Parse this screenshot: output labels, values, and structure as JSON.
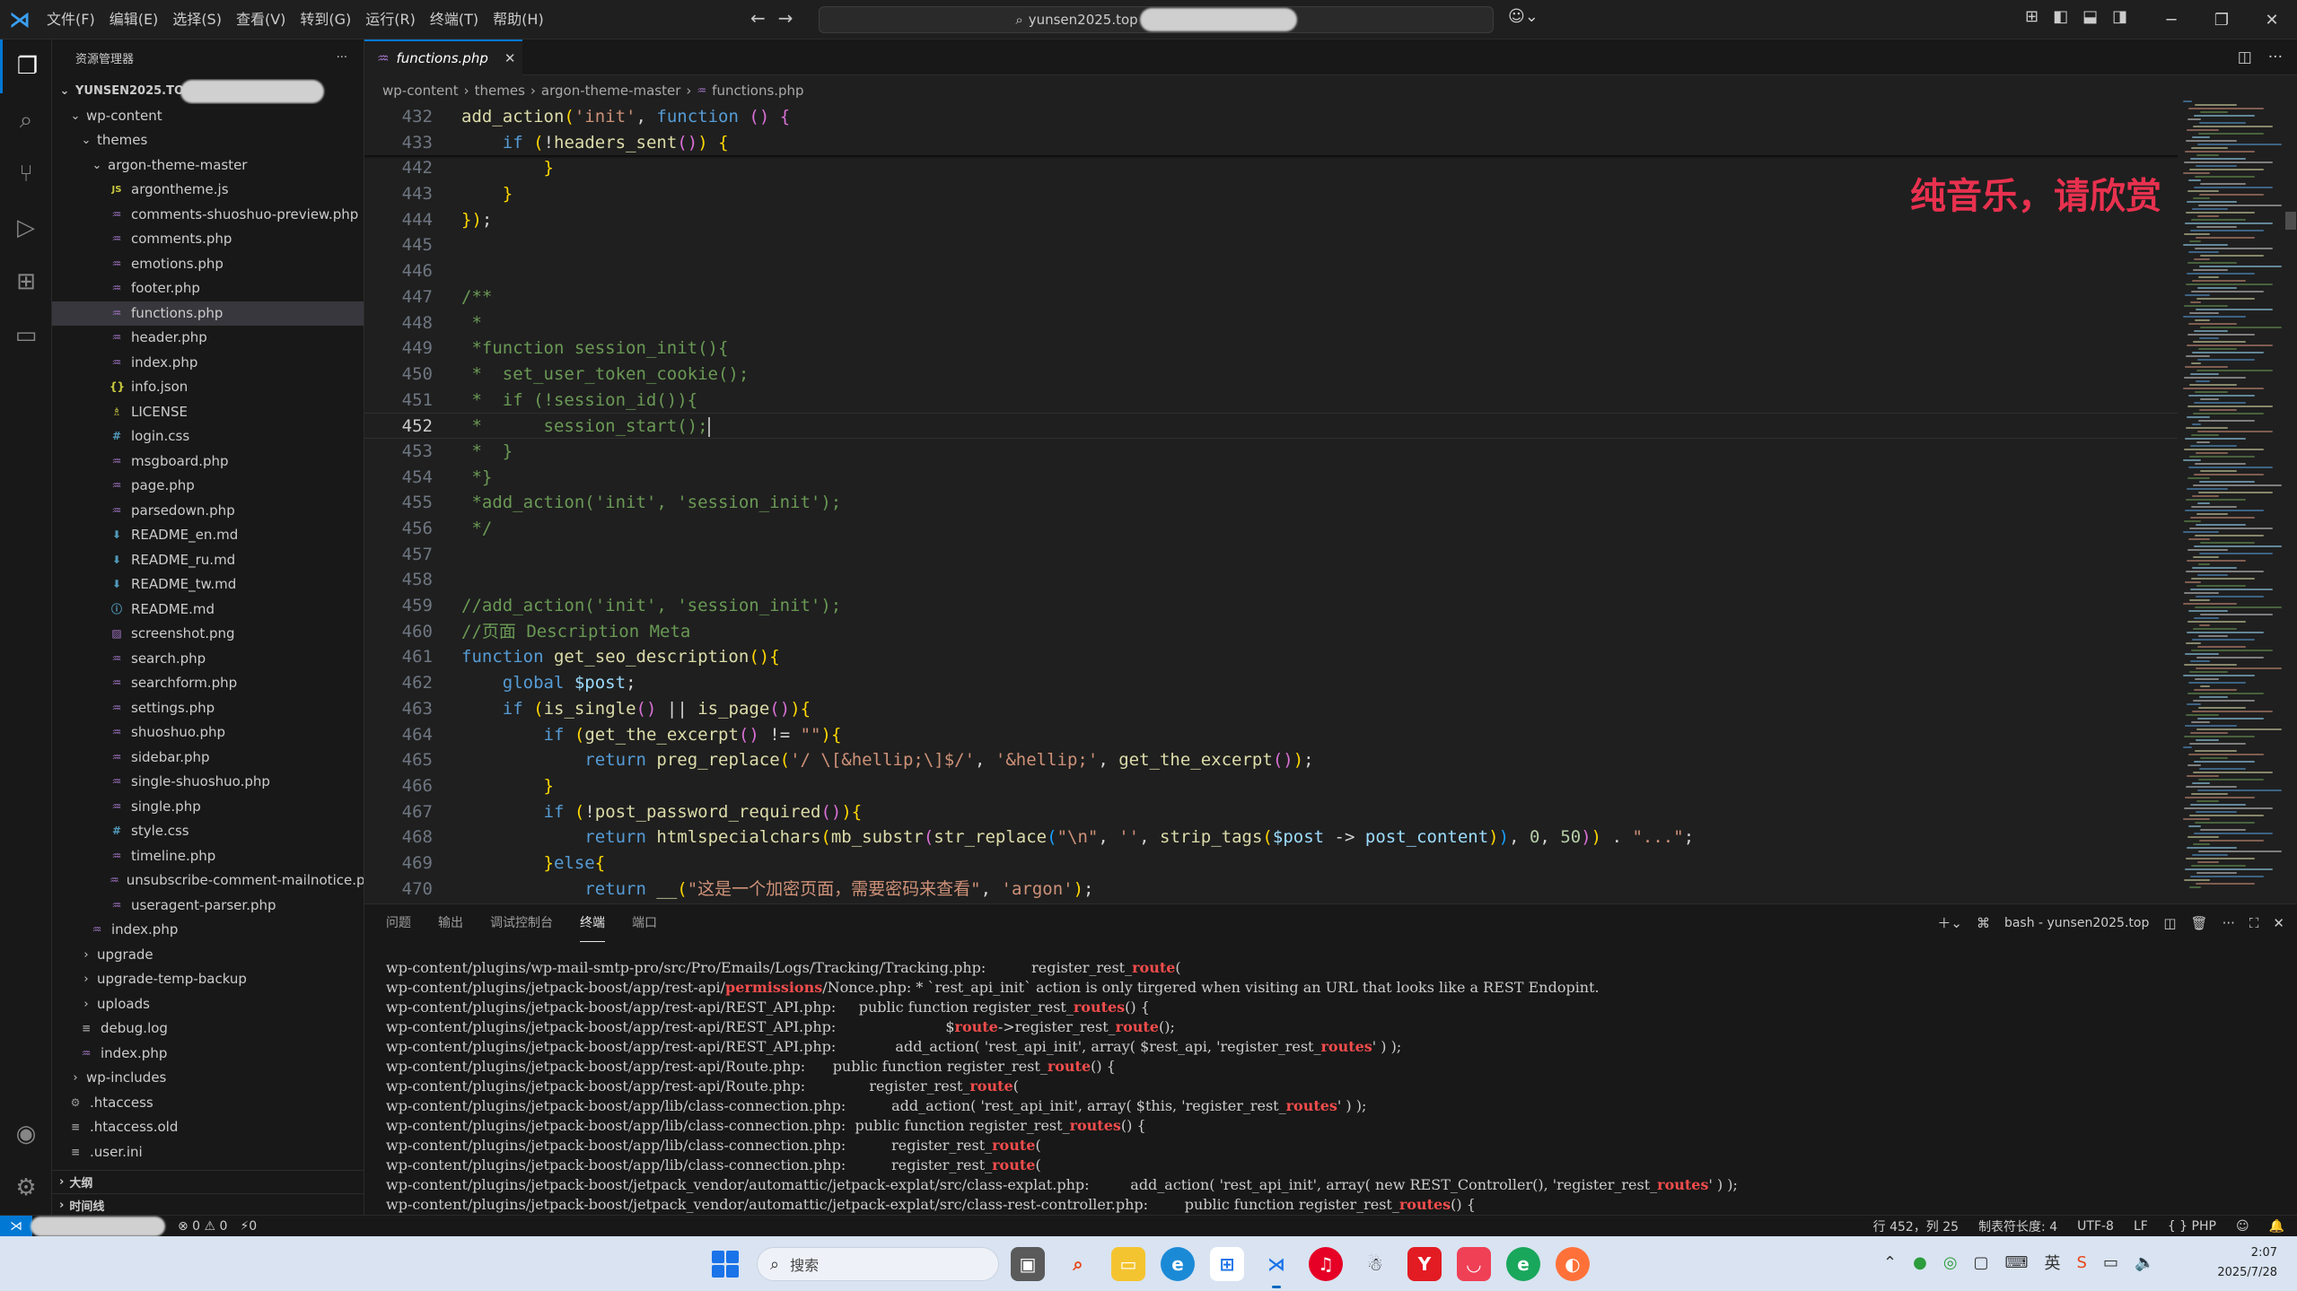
{
  "menu": [
    "文件(F)",
    "编辑(E)",
    "选择(S)",
    "查看(V)",
    "转到(G)",
    "运行(R)",
    "终端(T)",
    "帮助(H)"
  ],
  "command_center": {
    "text": "yunsen2025.top"
  },
  "explorer": {
    "title": "资源管理器",
    "root": "YUNSEN2025.TO",
    "tree": [
      {
        "label": "wp-content",
        "type": "folder-open",
        "depth": 1
      },
      {
        "label": "themes",
        "type": "folder-open",
        "depth": 2
      },
      {
        "label": "argon-theme-master",
        "type": "folder-open",
        "depth": 3
      },
      {
        "label": "argontheme.js",
        "type": "js",
        "depth": 4
      },
      {
        "label": "comments-shuoshuo-preview.php",
        "type": "php",
        "depth": 4
      },
      {
        "label": "comments.php",
        "type": "php",
        "depth": 4
      },
      {
        "label": "emotions.php",
        "type": "php",
        "depth": 4
      },
      {
        "label": "footer.php",
        "type": "php",
        "depth": 4
      },
      {
        "label": "functions.php",
        "type": "php",
        "depth": 4,
        "selected": true
      },
      {
        "label": "header.php",
        "type": "php",
        "depth": 4
      },
      {
        "label": "index.php",
        "type": "php",
        "depth": 4
      },
      {
        "label": "info.json",
        "type": "json",
        "depth": 4
      },
      {
        "label": "LICENSE",
        "type": "lic",
        "depth": 4
      },
      {
        "label": "login.css",
        "type": "css",
        "depth": 4
      },
      {
        "label": "msgboard.php",
        "type": "php",
        "depth": 4
      },
      {
        "label": "page.php",
        "type": "php",
        "depth": 4
      },
      {
        "label": "parsedown.php",
        "type": "php",
        "depth": 4
      },
      {
        "label": "README_en.md",
        "type": "md",
        "depth": 4
      },
      {
        "label": "README_ru.md",
        "type": "md",
        "depth": 4
      },
      {
        "label": "README_tw.md",
        "type": "md",
        "depth": 4
      },
      {
        "label": "README.md",
        "type": "info",
        "depth": 4
      },
      {
        "label": "screenshot.png",
        "type": "png",
        "depth": 4
      },
      {
        "label": "search.php",
        "type": "php",
        "depth": 4
      },
      {
        "label": "searchform.php",
        "type": "php",
        "depth": 4
      },
      {
        "label": "settings.php",
        "type": "php",
        "depth": 4
      },
      {
        "label": "shuoshuo.php",
        "type": "php",
        "depth": 4
      },
      {
        "label": "sidebar.php",
        "type": "php",
        "depth": 4
      },
      {
        "label": "single-shuoshuo.php",
        "type": "php",
        "depth": 4
      },
      {
        "label": "single.php",
        "type": "php",
        "depth": 4
      },
      {
        "label": "style.css",
        "type": "css",
        "depth": 4
      },
      {
        "label": "timeline.php",
        "type": "php",
        "depth": 4
      },
      {
        "label": "unsubscribe-comment-mailnotice.p...",
        "type": "php",
        "depth": 4
      },
      {
        "label": "useragent-parser.php",
        "type": "php",
        "depth": 4
      },
      {
        "label": "index.php",
        "type": "php",
        "depth": 3
      },
      {
        "label": "upgrade",
        "type": "folder",
        "depth": 2
      },
      {
        "label": "upgrade-temp-backup",
        "type": "folder",
        "depth": 2
      },
      {
        "label": "uploads",
        "type": "folder",
        "depth": 2
      },
      {
        "label": "debug.log",
        "type": "log",
        "depth": 2
      },
      {
        "label": "index.php",
        "type": "php",
        "depth": 2
      },
      {
        "label": "wp-includes",
        "type": "folder",
        "depth": 1
      },
      {
        "label": ".htaccess",
        "type": "gear",
        "depth": 1
      },
      {
        "label": ".htaccess.old",
        "type": "log",
        "depth": 1
      },
      {
        "label": ".user.ini",
        "type": "log",
        "depth": 1
      }
    ],
    "outline_label": "大纲",
    "timeline_label": "时间线"
  },
  "editor": {
    "tab_label": "functions.php",
    "breadcrumb": [
      "wp-content",
      "themes",
      "argon-theme-master",
      "functions.php"
    ],
    "lines": [
      {
        "n": "432",
        "t": "add_action('init', function () {"
      },
      {
        "n": "433",
        "t": "    if (!headers_sent()) {"
      },
      {
        "n": "442",
        "t": "        }"
      },
      {
        "n": "443",
        "t": "    }"
      },
      {
        "n": "444",
        "t": "});"
      },
      {
        "n": "445",
        "t": ""
      },
      {
        "n": "446",
        "t": ""
      },
      {
        "n": "447",
        "t": "/**"
      },
      {
        "n": "448",
        "t": " *"
      },
      {
        "n": "449",
        "t": " *function session_init(){"
      },
      {
        "n": "450",
        "t": " *  set_user_token_cookie();"
      },
      {
        "n": "451",
        "t": " *  if (!session_id()){"
      },
      {
        "n": "452",
        "t": " *      session_start();"
      },
      {
        "n": "453",
        "t": " *  }"
      },
      {
        "n": "454",
        "t": " *}"
      },
      {
        "n": "455",
        "t": " *add_action('init', 'session_init');"
      },
      {
        "n": "456",
        "t": " */"
      },
      {
        "n": "457",
        "t": ""
      },
      {
        "n": "458",
        "t": ""
      },
      {
        "n": "459",
        "t": "//add_action('init', 'session_init');"
      },
      {
        "n": "460",
        "t": "//页面 Description Meta"
      },
      {
        "n": "461",
        "t": "function get_seo_description(){"
      },
      {
        "n": "462",
        "t": "    global $post;"
      },
      {
        "n": "463",
        "t": "    if (is_single() || is_page()){"
      },
      {
        "n": "464",
        "t": "        if (get_the_excerpt() != \"\"){"
      },
      {
        "n": "465",
        "t": "            return preg_replace('/ \\[&hellip;\\]$/', '&hellip;', get_the_excerpt());"
      },
      {
        "n": "466",
        "t": "        }"
      },
      {
        "n": "467",
        "t": "        if (!post_password_required()){"
      },
      {
        "n": "468",
        "t": "            return htmlspecialchars(mb_substr(str_replace(\"\\n\", '', strip_tags($post -> post_content)), 0, 50)) . \"...\";"
      },
      {
        "n": "469",
        "t": "        }else{"
      },
      {
        "n": "470",
        "t": "            return __(\"这是一个加密页面，需要密码来查看\", 'argon');"
      }
    ],
    "current_line": "452",
    "overlay_title": "纯音乐，请欣赏"
  },
  "panel": {
    "tabs": [
      "问题",
      "输出",
      "调试控制台",
      "终端",
      "端口"
    ],
    "active_tab": "终端",
    "terminal_name": "bash - yunsen2025.top",
    "lines": [
      [
        "wp-content/plugins/wp-mail-smtp-pro/src/Pro/Emails/Logs/Tracking/Tracking.php:          register_rest_",
        "route",
        "("
      ],
      [
        "wp-content/plugins/jetpack-boost/app/rest-api/",
        "permissions",
        "/Nonce.php: * `rest_api_init` action is only tirgered when visiting an URL that looks like a REST Endopint."
      ],
      [
        "wp-content/plugins/jetpack-boost/app/rest-api/REST_API.php:     public function register_rest_",
        "routes",
        "() {"
      ],
      [
        "wp-content/plugins/jetpack-boost/app/rest-api/REST_API.php:                        $",
        "route",
        "->register_rest_",
        "route",
        "();"
      ],
      [
        "wp-content/plugins/jetpack-boost/app/rest-api/REST_API.php:             add_action( 'rest_api_init', array( $rest_api, 'register_rest_",
        "routes",
        "' ) );"
      ],
      [
        "wp-content/plugins/jetpack-boost/app/rest-api/Route.php:      public function register_rest_",
        "route",
        "() {"
      ],
      [
        "wp-content/plugins/jetpack-boost/app/rest-api/Route.php:              register_rest_",
        "route",
        "("
      ],
      [
        "wp-content/plugins/jetpack-boost/app/lib/class-connection.php:          add_action( 'rest_api_init', array( $this, 'register_rest_",
        "routes",
        "' ) );"
      ],
      [
        "wp-content/plugins/jetpack-boost/app/lib/class-connection.php:  public function register_rest_",
        "routes",
        "() {"
      ],
      [
        "wp-content/plugins/jetpack-boost/app/lib/class-connection.php:          register_rest_",
        "route",
        "("
      ],
      [
        "wp-content/plugins/jetpack-boost/app/lib/class-connection.php:          register_rest_",
        "route",
        "("
      ],
      [
        "wp-content/plugins/jetpack-boost/jetpack_vendor/automattic/jetpack-explat/src/class-explat.php:         add_action( 'rest_api_init', array( new REST_Controller(), 'register_rest_",
        "routes",
        "' ) );"
      ],
      [
        "wp-content/plugins/jetpack-boost/jetpack_vendor/automattic/jetpack-explat/src/class-rest-controller.php:        public function register_rest_",
        "routes",
        "() {"
      ]
    ]
  },
  "statusbar": {
    "problems": "⊗ 0 ⚠ 0",
    "ports": "⚡0",
    "position": "行 452，列 25",
    "tab_size": "制表符长度: 4",
    "encoding": "UTF-8",
    "eol": "LF",
    "language": "{ } PHP"
  },
  "taskbar": {
    "search_placeholder": "搜索",
    "clock_time": "2:07",
    "clock_date": "2025/7/28"
  },
  "colors": {
    "keyword": "#569cd6",
    "function": "#dcdcaa",
    "string": "#ce9178",
    "comment": "#6a9955",
    "variable": "#9cdcfe",
    "number": "#b5cea8",
    "brace": "#ffd700",
    "accent": "#0078d4"
  }
}
